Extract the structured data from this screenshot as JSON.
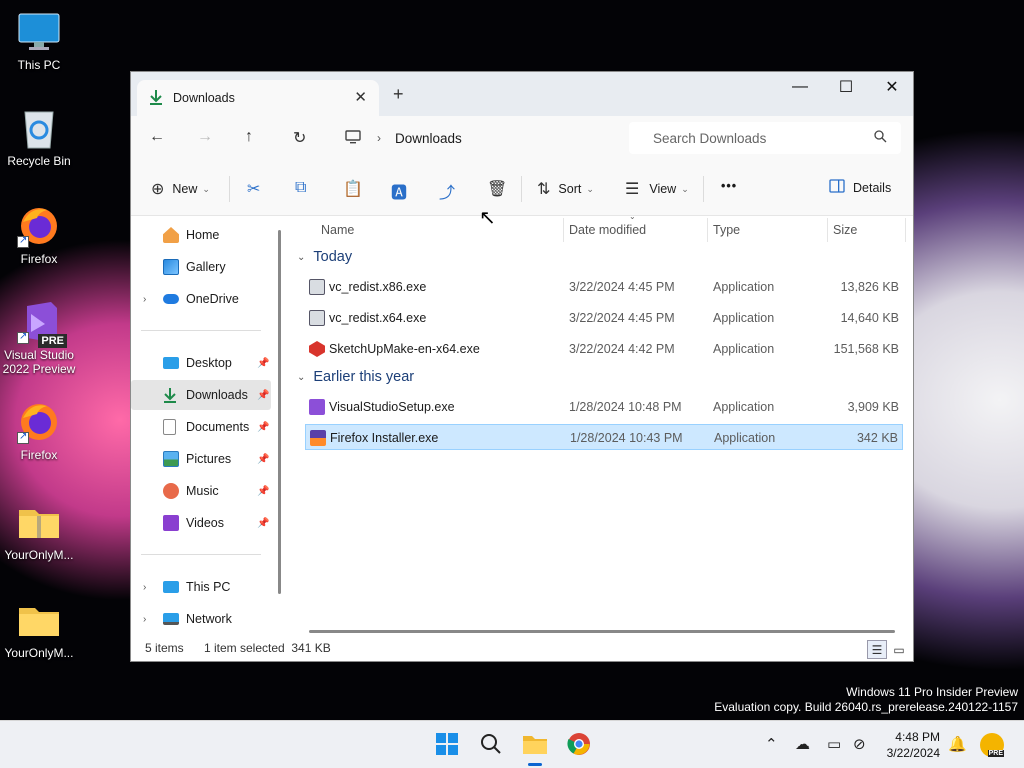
{
  "desktop": {
    "icons": [
      {
        "label": "This PC"
      },
      {
        "label": "Recycle Bin"
      },
      {
        "label": "Firefox"
      },
      {
        "label": "Visual Studio 2022 Preview",
        "badge": "PRE"
      },
      {
        "label": "Firefox"
      },
      {
        "label": "YourOnlyM..."
      },
      {
        "label": "YourOnlyM..."
      }
    ],
    "watermark": {
      "line1": "Windows 11 Pro Insider Preview",
      "line2": "Evaluation copy. Build 26040.rs_prerelease.240122-1157"
    }
  },
  "window": {
    "tab_title": "Downloads",
    "new_tab": "+",
    "controls": {
      "minimize": "—",
      "maximize": "☐",
      "close": "✕"
    },
    "address": {
      "location": "Downloads"
    },
    "search": {
      "placeholder": "Search Downloads"
    },
    "commands": {
      "new": "New",
      "sort": "Sort",
      "view": "View",
      "more": "•••",
      "details": "Details"
    },
    "sidebar": {
      "items": [
        {
          "label": "Home"
        },
        {
          "label": "Gallery"
        },
        {
          "label": "OneDrive"
        },
        {
          "label": "Desktop"
        },
        {
          "label": "Downloads"
        },
        {
          "label": "Documents"
        },
        {
          "label": "Pictures"
        },
        {
          "label": "Music"
        },
        {
          "label": "Videos"
        },
        {
          "label": "This PC"
        },
        {
          "label": "Network"
        }
      ]
    },
    "columns": {
      "name": "Name",
      "date": "Date modified",
      "type": "Type",
      "size": "Size"
    },
    "groups": {
      "today": {
        "label": "Today",
        "files": [
          {
            "name": "vc_redist.x86.exe",
            "date": "3/22/2024 4:45 PM",
            "type": "Application",
            "size": "13,826 KB"
          },
          {
            "name": "vc_redist.x64.exe",
            "date": "3/22/2024 4:45 PM",
            "type": "Application",
            "size": "14,640 KB"
          },
          {
            "name": "SketchUpMake-en-x64.exe",
            "date": "3/22/2024 4:42 PM",
            "type": "Application",
            "size": "151,568 KB"
          }
        ]
      },
      "earlier": {
        "label": "Earlier this year",
        "files": [
          {
            "name": "VisualStudioSetup.exe",
            "date": "1/28/2024 10:48 PM",
            "type": "Application",
            "size": "3,909 KB"
          },
          {
            "name": "Firefox Installer.exe",
            "date": "1/28/2024 10:43 PM",
            "type": "Application",
            "size": "342 KB"
          }
        ]
      }
    },
    "status": {
      "count": "5 items",
      "selection": "1 item selected  341 KB"
    }
  },
  "taskbar": {
    "clock": {
      "time": "4:48 PM",
      "date": "3/22/2024"
    },
    "tray_badge": "PRE"
  },
  "colors": {
    "accent": "#0a64d0",
    "selection": "#cde8ff",
    "download_green": "#1e8a4a"
  }
}
